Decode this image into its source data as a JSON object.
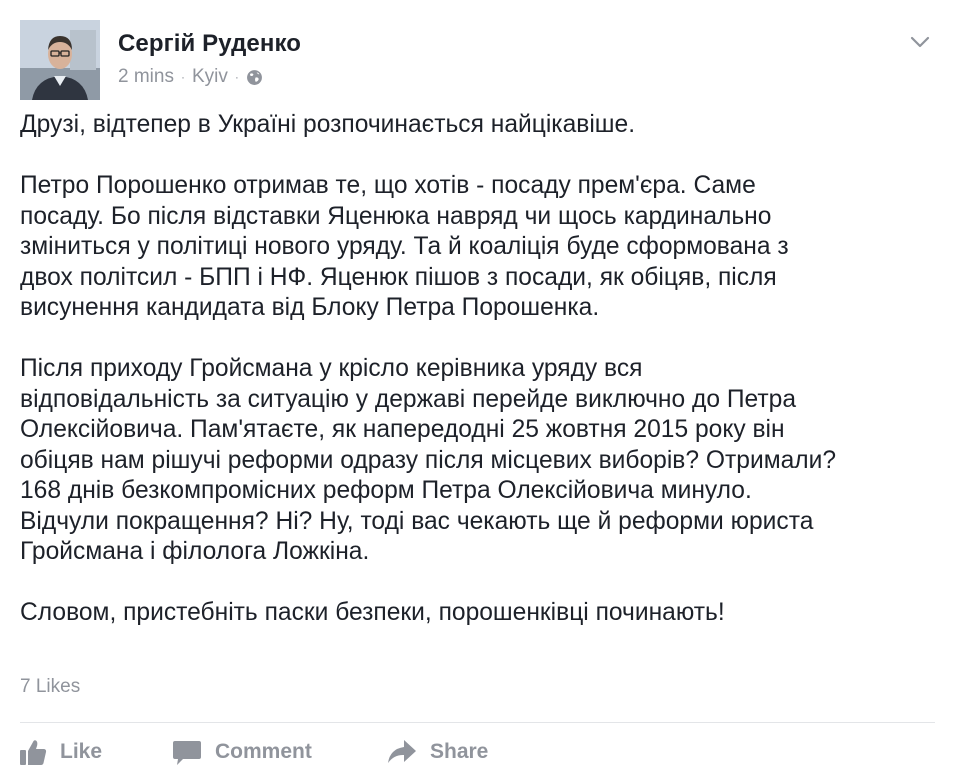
{
  "post": {
    "author": "Сергій Руденко",
    "time": "2 mins",
    "location": "Kyiv",
    "separator": "·",
    "audience_icon": "globe-icon",
    "menu_icon": "chevron-down-icon",
    "paragraphs": [
      "Друзі, відтепер в Україні розпочинається найцікавіше.",
      "Петро Порошенко отримав те, що хотів - посаду прем'єра. Саме\nпосаду. Бо після відставки Яценюка навряд чи щось кардинально\nзміниться у політиці нового уряду. Та й коаліція буде сформована з\nдвох політсил - БПП і НФ. Яценюк пішов з посади, як обіцяв, після\nвисунення кандидата від Блоку Петра Порошенка.",
      "Після приходу Гройсмана у крісло керівника уряду вся\nвідповідальність за ситуацію у державі перейде виключно до Петра\nОлексійовича. Пам'ятаєте, як напередодні 25 жовтня 2015 року він\nобіцяв нам рішучі реформи одразу після місцевих виборів? Отримали?\n168 днів безкомпромісних реформ Петра Олексійовича минуло.\nВідчули покращення? Ні? Ну, тоді вас чекають ще й реформи юриста\nГройсмана і філолога Ложкіна.",
      "Словом, пристебніть паски безпеки, порошенківці починають!"
    ],
    "likes": "7 Likes"
  },
  "actions": {
    "like_label": "Like",
    "like_icon": "thumbs-up-icon",
    "comment_label": "Comment",
    "comment_icon": "speech-bubble-icon",
    "share_label": "Share",
    "share_icon": "share-arrow-icon"
  },
  "colors": {
    "text_primary": "#1d2129",
    "text_secondary": "#90949c",
    "divider": "#e3e5e8",
    "background": "#ffffff"
  }
}
